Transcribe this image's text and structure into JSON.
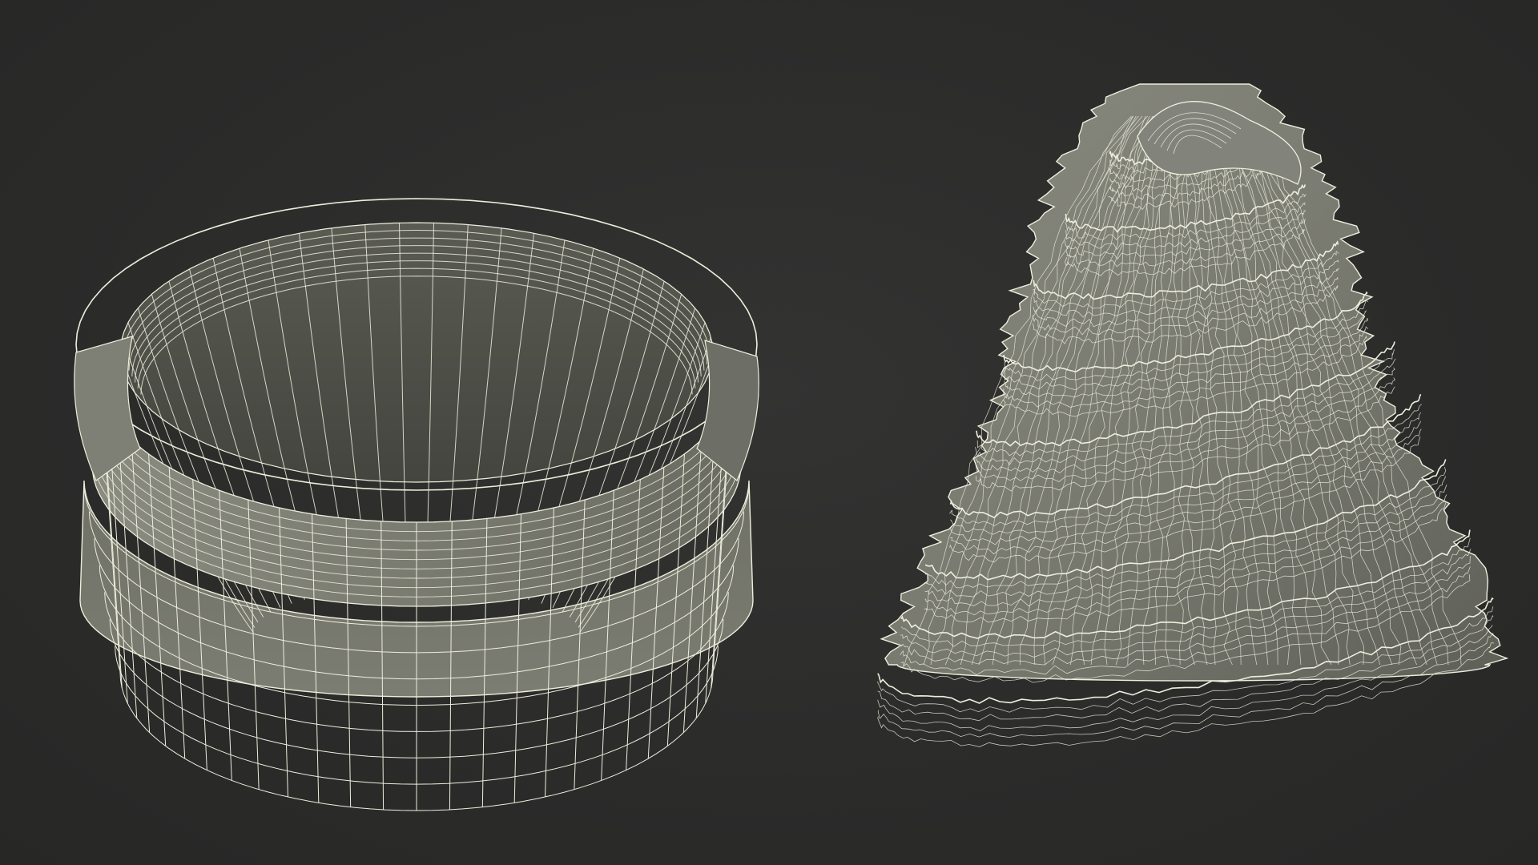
{
  "scene": {
    "background_color": "#2b2b2a",
    "mesh_fill_dark": "#4a4b44",
    "mesh_fill_light": "#7a7b70",
    "wire_color": "#eeeedd",
    "objects": [
      {
        "name": "bowl",
        "kind": "wireframe-bowl"
      },
      {
        "name": "swirl-mound",
        "kind": "wireframe-spiral-mound"
      }
    ]
  }
}
